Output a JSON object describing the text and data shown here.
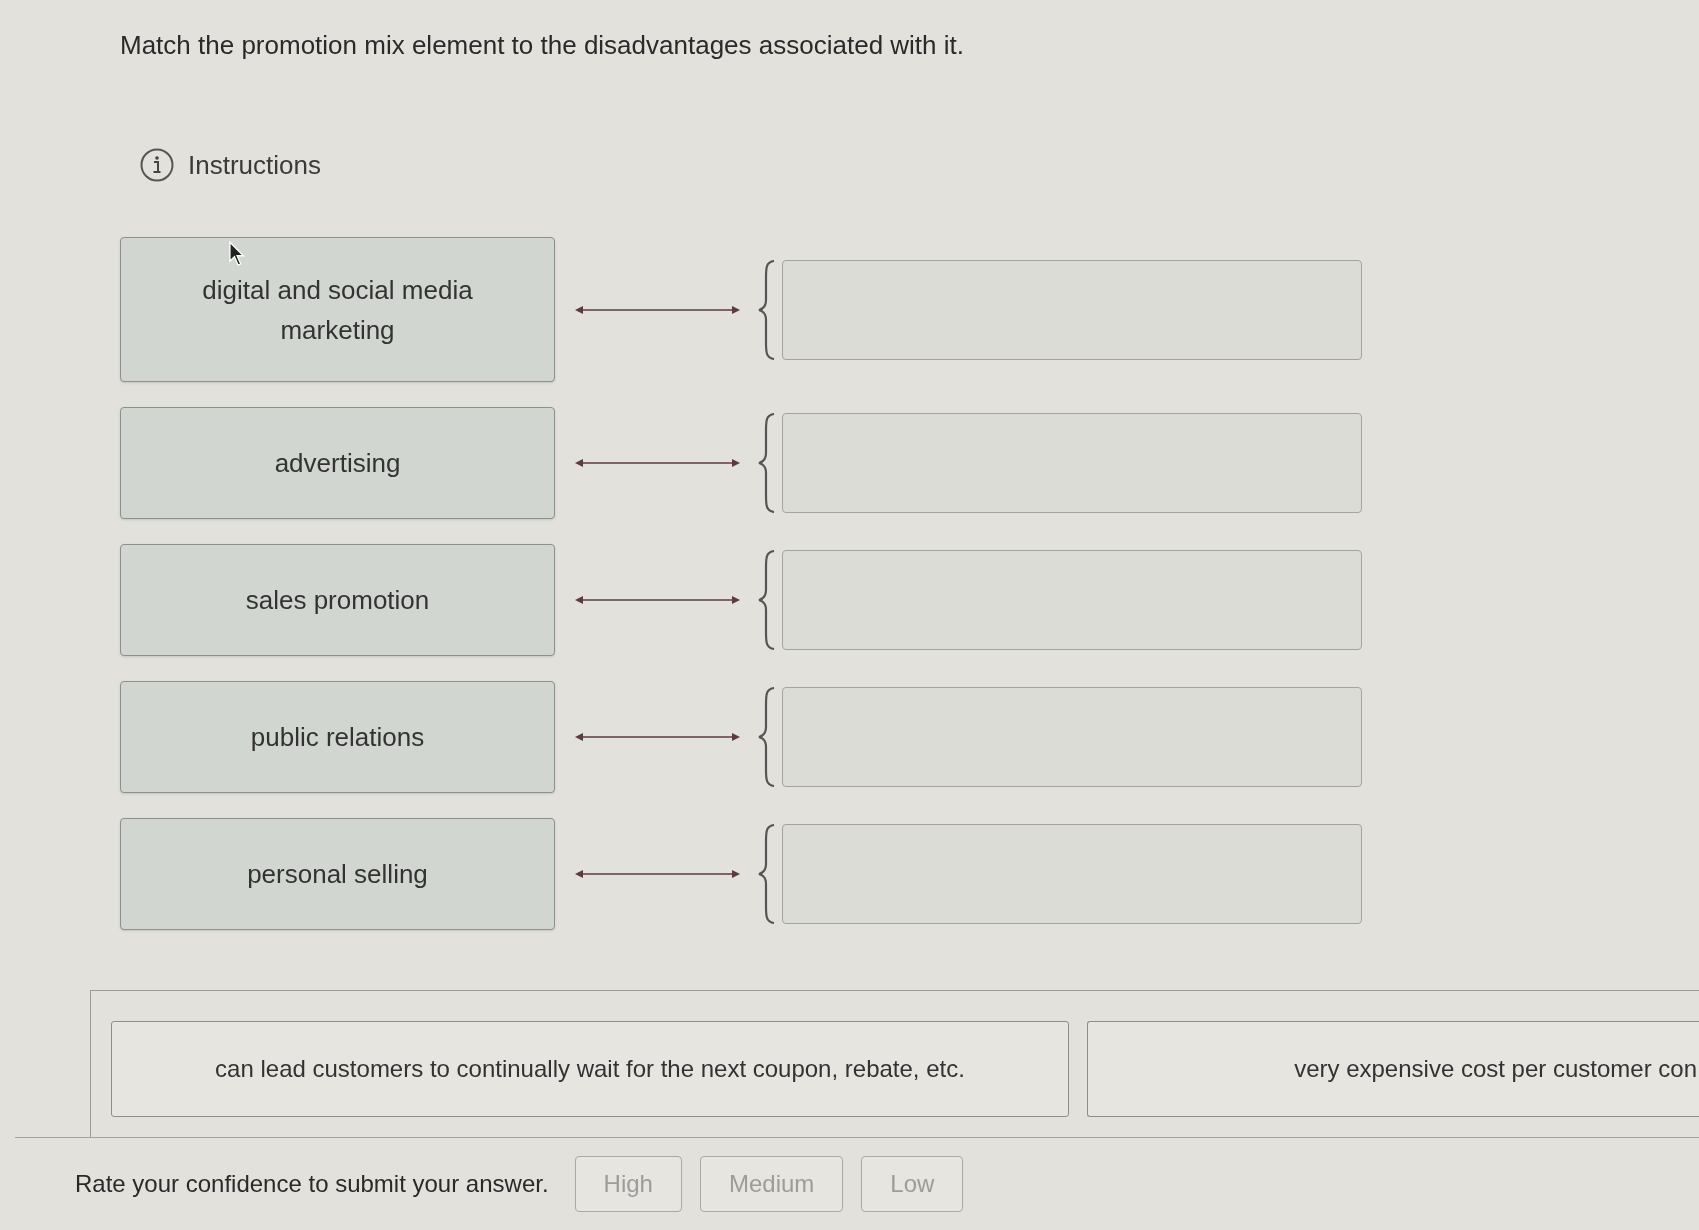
{
  "question": {
    "prompt": "Match the promotion mix element to the disadvantages associated with it.",
    "instructions_label": "Instructions"
  },
  "matches": [
    {
      "term": "digital and social media marketing"
    },
    {
      "term": "advertising"
    },
    {
      "term": "sales promotion"
    },
    {
      "term": "public relations"
    },
    {
      "term": "personal selling"
    }
  ],
  "answer_bank": [
    {
      "text": "can lead customers to continually wait for the next coupon, rebate, etc."
    },
    {
      "text": "very expensive cost per customer con"
    }
  ],
  "confidence": {
    "prompt": "Rate your confidence to submit your answer.",
    "buttons": [
      {
        "label": "High",
        "disabled": true
      },
      {
        "label": "Medium",
        "disabled": true
      },
      {
        "label": "Low",
        "disabled": true
      }
    ]
  }
}
